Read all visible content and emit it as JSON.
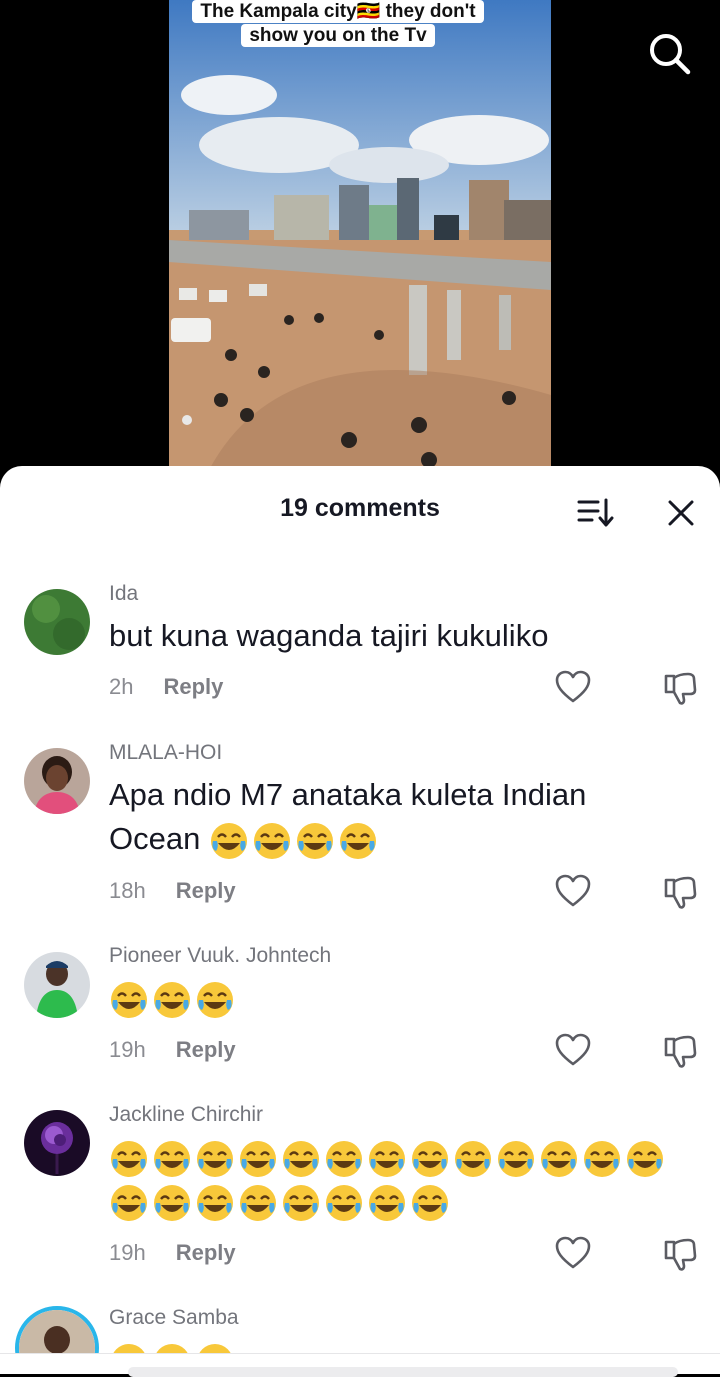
{
  "video": {
    "caption": "The Kampala city🇺🇬 they don't show you on the Tv"
  },
  "icons": {
    "search": "search-icon",
    "sort": "sort-icon",
    "close": "close-icon",
    "like": "heart-icon",
    "dislike": "thumbs-down-icon",
    "emoji": "face-with-tears-of-joy-emoji"
  },
  "comments_panel": {
    "title": "19 comments",
    "comments": [
      {
        "username": "Ida",
        "text": "but kuna waganda tajiri kukuliko",
        "time": "2h",
        "reply_label": "Reply",
        "emoji_rows": []
      },
      {
        "username": "MLALA-HOI",
        "text": "Apa ndio M7 anataka kuleta Indian Ocean",
        "time": "18h",
        "reply_label": "Reply",
        "emoji_rows": []
      },
      {
        "username": "Pioneer Vuuk. Johntech",
        "text": "",
        "time": "19h",
        "reply_label": "Reply",
        "emoji_rows": [
          3
        ]
      },
      {
        "username": "Jackline Chirchir",
        "text": "",
        "time": "19h",
        "reply_label": "Reply",
        "emoji_rows": [
          13,
          8
        ]
      },
      {
        "username": "Grace Samba",
        "text": "",
        "time": "",
        "reply_label": "",
        "emoji_rows": [
          3
        ]
      }
    ]
  },
  "colors": {
    "text_primary": "#161823",
    "text_secondary": "#73757c",
    "sheet_bg": "#ffffff",
    "emoji_face": "#f8c83a",
    "avatar_ring": "#29b6ea"
  }
}
